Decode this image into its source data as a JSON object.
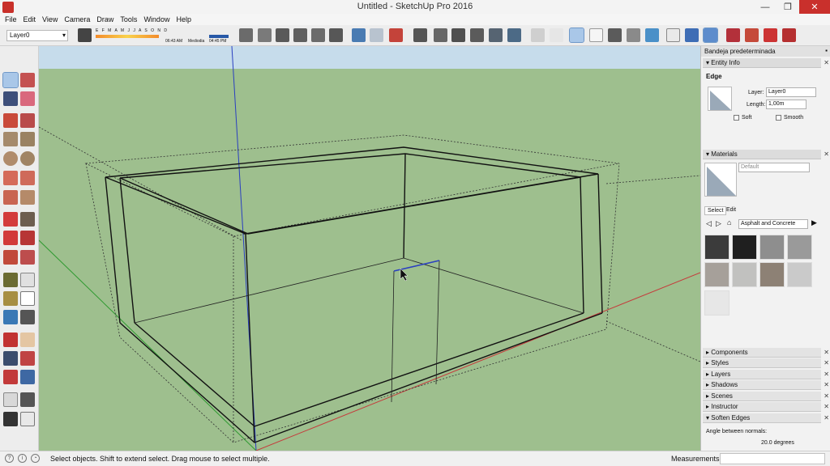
{
  "window": {
    "title": "Untitled - SketchUp Pro 2016",
    "minimize": "—",
    "maximize": "❐",
    "close": "✕"
  },
  "menu": [
    "File",
    "Edit",
    "View",
    "Camera",
    "Draw",
    "Tools",
    "Window",
    "Help"
  ],
  "toolbar": {
    "layer_value": "Layer0",
    "months": "E F M A M J J A S O N D",
    "time_left": "06:43 AM",
    "time_mid": "Mediodia",
    "time_right": "04:45 PM"
  },
  "status": {
    "text": "Select objects. Shift to extend select. Drag mouse to select multiple.",
    "measurements_label": "Measurements"
  },
  "tray": {
    "title": "Bandeja predeterminada",
    "entity_info": {
      "header": "Entity Info",
      "entity_type": "Edge",
      "layer_label": "Layer:",
      "layer_value": "Layer0",
      "length_label": "Length:",
      "length_value": "1,00m",
      "soft_label": "Soft",
      "smooth_label": "Smooth"
    },
    "materials": {
      "header": "Materials",
      "material_name": "Default",
      "tab_select": "Select",
      "tab_edit": "Edit",
      "library": "Asphalt and Concrete"
    },
    "panels": [
      "Components",
      "Styles",
      "Layers",
      "Shadows",
      "Scenes",
      "Instructor",
      "Soften Edges"
    ],
    "soften_edges": {
      "angle_label": "Angle between normals:",
      "angle_value": "20.0  degrees"
    }
  },
  "colors": {
    "viewport_ground": "#9ebf8e",
    "viewport_sky": "#c6dceb",
    "axis_red": "#c53b3b",
    "axis_green": "#2f9a31",
    "axis_blue": "#2a3fc0",
    "selection_blue": "#a9c7e8"
  }
}
